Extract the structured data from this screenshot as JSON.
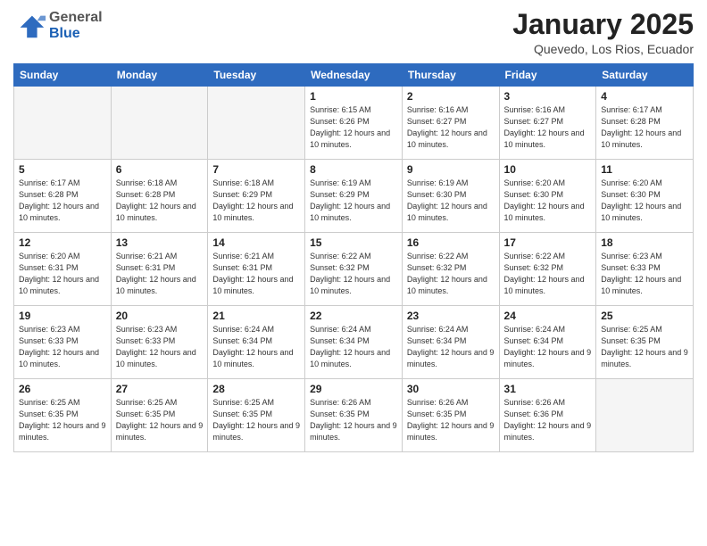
{
  "logo": {
    "general": "General",
    "blue": "Blue"
  },
  "header": {
    "month": "January 2025",
    "location": "Quevedo, Los Rios, Ecuador"
  },
  "days_of_week": [
    "Sunday",
    "Monday",
    "Tuesday",
    "Wednesday",
    "Thursday",
    "Friday",
    "Saturday"
  ],
  "weeks": [
    [
      {
        "day": "",
        "info": ""
      },
      {
        "day": "",
        "info": ""
      },
      {
        "day": "",
        "info": ""
      },
      {
        "day": "1",
        "info": "Sunrise: 6:15 AM\nSunset: 6:26 PM\nDaylight: 12 hours\nand 10 minutes."
      },
      {
        "day": "2",
        "info": "Sunrise: 6:16 AM\nSunset: 6:27 PM\nDaylight: 12 hours\nand 10 minutes."
      },
      {
        "day": "3",
        "info": "Sunrise: 6:16 AM\nSunset: 6:27 PM\nDaylight: 12 hours\nand 10 minutes."
      },
      {
        "day": "4",
        "info": "Sunrise: 6:17 AM\nSunset: 6:28 PM\nDaylight: 12 hours\nand 10 minutes."
      }
    ],
    [
      {
        "day": "5",
        "info": "Sunrise: 6:17 AM\nSunset: 6:28 PM\nDaylight: 12 hours\nand 10 minutes."
      },
      {
        "day": "6",
        "info": "Sunrise: 6:18 AM\nSunset: 6:28 PM\nDaylight: 12 hours\nand 10 minutes."
      },
      {
        "day": "7",
        "info": "Sunrise: 6:18 AM\nSunset: 6:29 PM\nDaylight: 12 hours\nand 10 minutes."
      },
      {
        "day": "8",
        "info": "Sunrise: 6:19 AM\nSunset: 6:29 PM\nDaylight: 12 hours\nand 10 minutes."
      },
      {
        "day": "9",
        "info": "Sunrise: 6:19 AM\nSunset: 6:30 PM\nDaylight: 12 hours\nand 10 minutes."
      },
      {
        "day": "10",
        "info": "Sunrise: 6:20 AM\nSunset: 6:30 PM\nDaylight: 12 hours\nand 10 minutes."
      },
      {
        "day": "11",
        "info": "Sunrise: 6:20 AM\nSunset: 6:30 PM\nDaylight: 12 hours\nand 10 minutes."
      }
    ],
    [
      {
        "day": "12",
        "info": "Sunrise: 6:20 AM\nSunset: 6:31 PM\nDaylight: 12 hours\nand 10 minutes."
      },
      {
        "day": "13",
        "info": "Sunrise: 6:21 AM\nSunset: 6:31 PM\nDaylight: 12 hours\nand 10 minutes."
      },
      {
        "day": "14",
        "info": "Sunrise: 6:21 AM\nSunset: 6:31 PM\nDaylight: 12 hours\nand 10 minutes."
      },
      {
        "day": "15",
        "info": "Sunrise: 6:22 AM\nSunset: 6:32 PM\nDaylight: 12 hours\nand 10 minutes."
      },
      {
        "day": "16",
        "info": "Sunrise: 6:22 AM\nSunset: 6:32 PM\nDaylight: 12 hours\nand 10 minutes."
      },
      {
        "day": "17",
        "info": "Sunrise: 6:22 AM\nSunset: 6:32 PM\nDaylight: 12 hours\nand 10 minutes."
      },
      {
        "day": "18",
        "info": "Sunrise: 6:23 AM\nSunset: 6:33 PM\nDaylight: 12 hours\nand 10 minutes."
      }
    ],
    [
      {
        "day": "19",
        "info": "Sunrise: 6:23 AM\nSunset: 6:33 PM\nDaylight: 12 hours\nand 10 minutes."
      },
      {
        "day": "20",
        "info": "Sunrise: 6:23 AM\nSunset: 6:33 PM\nDaylight: 12 hours\nand 10 minutes."
      },
      {
        "day": "21",
        "info": "Sunrise: 6:24 AM\nSunset: 6:34 PM\nDaylight: 12 hours\nand 10 minutes."
      },
      {
        "day": "22",
        "info": "Sunrise: 6:24 AM\nSunset: 6:34 PM\nDaylight: 12 hours\nand 10 minutes."
      },
      {
        "day": "23",
        "info": "Sunrise: 6:24 AM\nSunset: 6:34 PM\nDaylight: 12 hours\nand 9 minutes."
      },
      {
        "day": "24",
        "info": "Sunrise: 6:24 AM\nSunset: 6:34 PM\nDaylight: 12 hours\nand 9 minutes."
      },
      {
        "day": "25",
        "info": "Sunrise: 6:25 AM\nSunset: 6:35 PM\nDaylight: 12 hours\nand 9 minutes."
      }
    ],
    [
      {
        "day": "26",
        "info": "Sunrise: 6:25 AM\nSunset: 6:35 PM\nDaylight: 12 hours\nand 9 minutes."
      },
      {
        "day": "27",
        "info": "Sunrise: 6:25 AM\nSunset: 6:35 PM\nDaylight: 12 hours\nand 9 minutes."
      },
      {
        "day": "28",
        "info": "Sunrise: 6:25 AM\nSunset: 6:35 PM\nDaylight: 12 hours\nand 9 minutes."
      },
      {
        "day": "29",
        "info": "Sunrise: 6:26 AM\nSunset: 6:35 PM\nDaylight: 12 hours\nand 9 minutes."
      },
      {
        "day": "30",
        "info": "Sunrise: 6:26 AM\nSunset: 6:35 PM\nDaylight: 12 hours\nand 9 minutes."
      },
      {
        "day": "31",
        "info": "Sunrise: 6:26 AM\nSunset: 6:36 PM\nDaylight: 12 hours\nand 9 minutes."
      },
      {
        "day": "",
        "info": ""
      }
    ]
  ]
}
